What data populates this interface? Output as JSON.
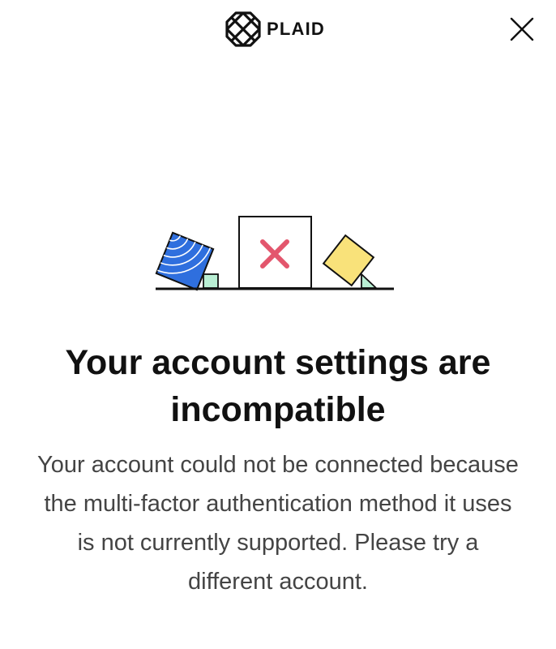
{
  "header": {
    "brand_name": "PLAID",
    "logo_icon": "plaid-logo-icon",
    "close_icon": "close-icon"
  },
  "illustration": {
    "description_icons": [
      "blue-tilted-square",
      "green-small-cube",
      "error-box-with-x",
      "yellow-diamond",
      "green-triangle"
    ],
    "colors": {
      "blue": "#2f6fde",
      "green": "#b9efd4",
      "yellow": "#f9e27a",
      "error_red": "#e3566d",
      "ink": "#111111"
    }
  },
  "content": {
    "title": "Your account settings are incompatible",
    "message": "Your account could not be connected because the multi-factor authentication method it uses is not currently supported. Please try a different account."
  }
}
